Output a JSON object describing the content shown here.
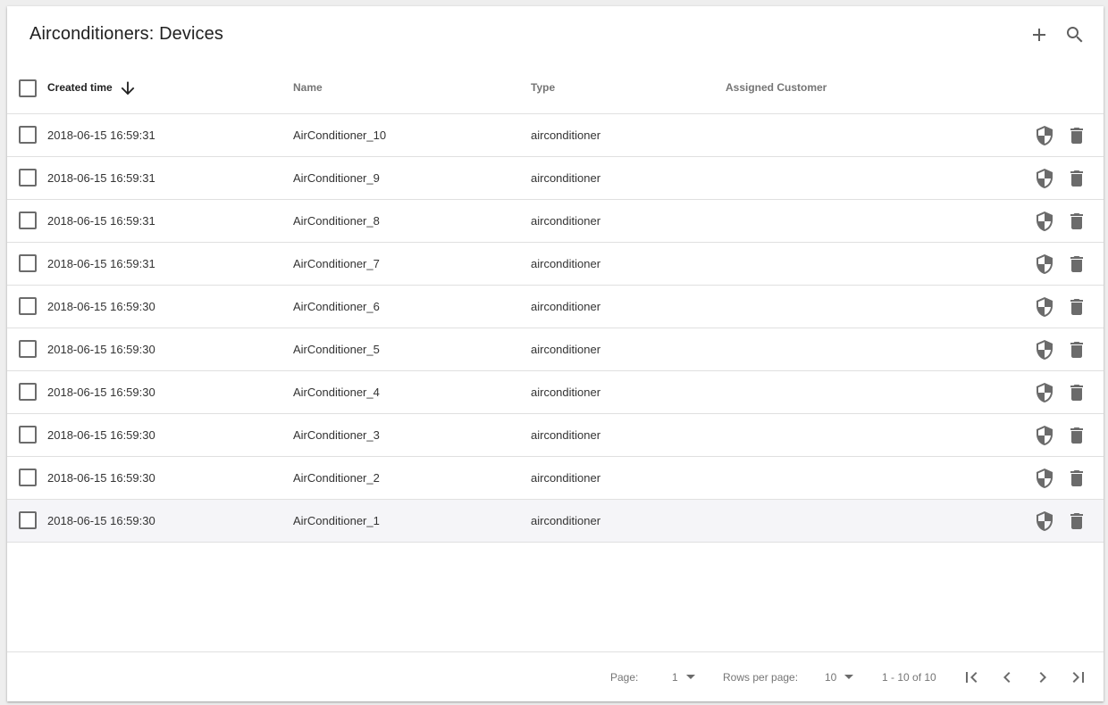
{
  "toolbar": {
    "title": "Airconditioners: Devices",
    "add_icon": "add-icon",
    "search_icon": "search-icon"
  },
  "table": {
    "columns": {
      "created_time": "Created time",
      "name": "Name",
      "type": "Type",
      "assigned_customer": "Assigned Customer"
    },
    "sort": {
      "column": "created_time",
      "direction": "desc",
      "icon": "arrow-down-icon"
    },
    "rows": [
      {
        "created_time": "2018-06-15 16:59:31",
        "name": "AirConditioner_10",
        "type": "airconditioner",
        "assigned_customer": ""
      },
      {
        "created_time": "2018-06-15 16:59:31",
        "name": "AirConditioner_9",
        "type": "airconditioner",
        "assigned_customer": ""
      },
      {
        "created_time": "2018-06-15 16:59:31",
        "name": "AirConditioner_8",
        "type": "airconditioner",
        "assigned_customer": ""
      },
      {
        "created_time": "2018-06-15 16:59:31",
        "name": "AirConditioner_7",
        "type": "airconditioner",
        "assigned_customer": ""
      },
      {
        "created_time": "2018-06-15 16:59:30",
        "name": "AirConditioner_6",
        "type": "airconditioner",
        "assigned_customer": ""
      },
      {
        "created_time": "2018-06-15 16:59:30",
        "name": "AirConditioner_5",
        "type": "airconditioner",
        "assigned_customer": ""
      },
      {
        "created_time": "2018-06-15 16:59:30",
        "name": "AirConditioner_4",
        "type": "airconditioner",
        "assigned_customer": ""
      },
      {
        "created_time": "2018-06-15 16:59:30",
        "name": "AirConditioner_3",
        "type": "airconditioner",
        "assigned_customer": ""
      },
      {
        "created_time": "2018-06-15 16:59:30",
        "name": "AirConditioner_2",
        "type": "airconditioner",
        "assigned_customer": ""
      },
      {
        "created_time": "2018-06-15 16:59:30",
        "name": "AirConditioner_1",
        "type": "airconditioner",
        "assigned_customer": ""
      }
    ],
    "row_actions": {
      "assign_icon": "shield-icon",
      "delete_icon": "trash-icon"
    },
    "highlighted_row_index": 9
  },
  "pagination": {
    "page_label": "Page:",
    "page_value": "1",
    "rows_per_page_label": "Rows per page:",
    "rows_per_page_value": "10",
    "range_text": "1 - 10 of 10",
    "first_icon": "first-page-icon",
    "prev_icon": "chevron-left-icon",
    "next_icon": "chevron-right-icon",
    "last_icon": "last-page-icon"
  },
  "colors": {
    "icon": "#6b6b6b",
    "divider": "#e0e0e0",
    "highlight_row": "#f5f5f8",
    "header_text": "#757575"
  }
}
